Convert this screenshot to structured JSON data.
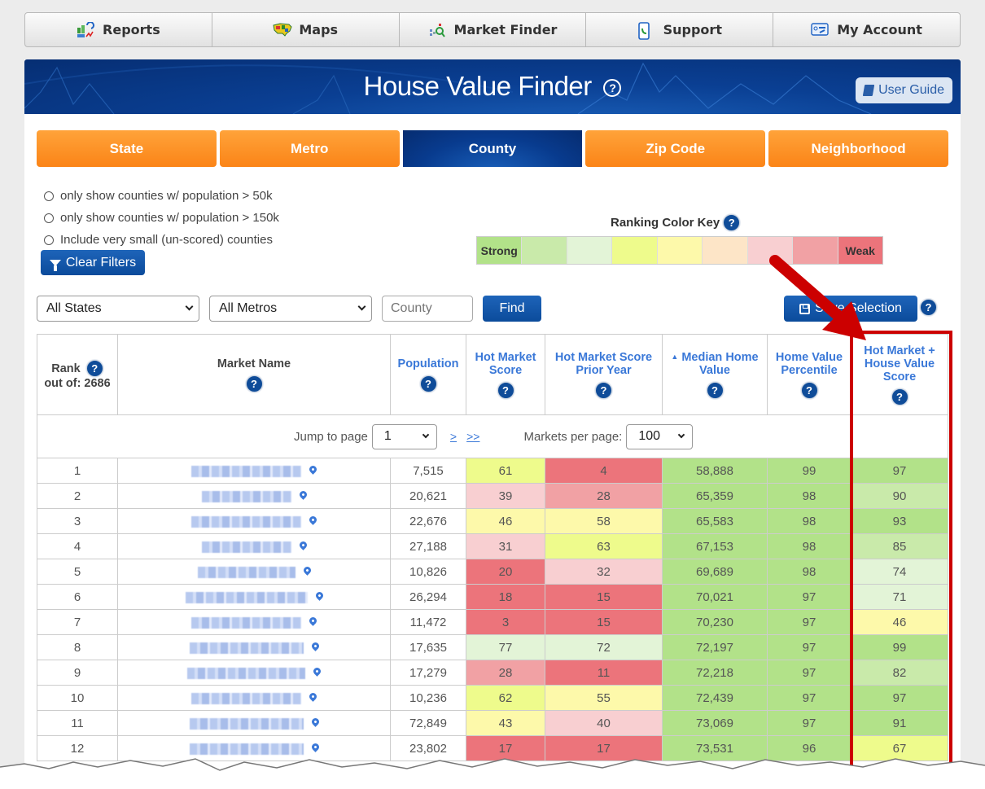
{
  "nav": {
    "items": [
      {
        "label": "Reports",
        "icon": "reports-chart-icon"
      },
      {
        "label": "Maps",
        "icon": "us-map-icon"
      },
      {
        "label": "Market Finder",
        "icon": "magnifier-icon"
      },
      {
        "label": "Support",
        "icon": "phone-icon"
      },
      {
        "label": "My Account",
        "icon": "account-card-icon"
      }
    ]
  },
  "header": {
    "title": "House Value Finder",
    "help_glyph": "?",
    "user_guide_label": "User Guide"
  },
  "tabs": [
    {
      "label": "State",
      "active": false
    },
    {
      "label": "Metro",
      "active": false
    },
    {
      "label": "County",
      "active": true
    },
    {
      "label": "Zip Code",
      "active": false
    },
    {
      "label": "Neighborhood",
      "active": false
    }
  ],
  "filters": {
    "options": [
      {
        "label": "only show counties w/ population > 50k",
        "checked": false
      },
      {
        "label": "only show counties w/ population > 150k",
        "checked": false
      },
      {
        "label": "Include very small (un-scored) counties",
        "checked": false
      }
    ],
    "clear_label": "Clear Filters"
  },
  "color_key": {
    "title": "Ranking Color Key",
    "strong_label": "Strong",
    "weak_label": "Weak",
    "colors": [
      "#b2e289",
      "#c9eaaa",
      "#e3f4d7",
      "#eefb8c",
      "#fdf9aa",
      "#fde5c7",
      "#f8cfd1",
      "#f1a1a4",
      "#ec747b"
    ]
  },
  "search": {
    "state_select": "All States",
    "metro_select": "All Metros",
    "county_placeholder": "County",
    "find_label": "Find",
    "save_label": "Save Selection",
    "help_glyph": "?"
  },
  "table": {
    "columns": [
      {
        "label": "Rank",
        "sub": "out of: 2686",
        "link": false
      },
      {
        "label": "Market Name",
        "link": false
      },
      {
        "label": "Population",
        "link": true
      },
      {
        "label": "Hot Market Score",
        "link": true
      },
      {
        "label": "Hot Market Score Prior Year",
        "link": true
      },
      {
        "label": "Median Home Value",
        "link": true,
        "sorted": "asc",
        "sort_glyph": "▲"
      },
      {
        "label": "Home Value Percentile",
        "link": true
      },
      {
        "label": "Hot Market + House Value Score",
        "link": true
      }
    ],
    "pager": {
      "jump_label": "Jump to page",
      "page": "1",
      "next": ">",
      "last": ">>",
      "per_page_label": "Markets per page:",
      "per_page": "100"
    },
    "rows": [
      {
        "rank": "1",
        "name_width": 135,
        "pop": "7,515",
        "hms": "61",
        "hms_c": 3,
        "prior": "4",
        "prior_c": 8,
        "mhv": "58,888",
        "pct": "99",
        "combo": "97",
        "combo_c": 0
      },
      {
        "rank": "2",
        "name_width": 110,
        "pop": "20,621",
        "hms": "39",
        "hms_c": 6,
        "prior": "28",
        "prior_c": 7,
        "mhv": "65,359",
        "pct": "98",
        "combo": "90",
        "combo_c": 1
      },
      {
        "rank": "3",
        "name_width": 135,
        "pop": "22,676",
        "hms": "46",
        "hms_c": 4,
        "prior": "58",
        "prior_c": 4,
        "mhv": "65,583",
        "pct": "98",
        "combo": "93",
        "combo_c": 0
      },
      {
        "rank": "4",
        "name_width": 110,
        "pop": "27,188",
        "hms": "31",
        "hms_c": 6,
        "prior": "63",
        "prior_c": 3,
        "mhv": "67,153",
        "pct": "98",
        "combo": "85",
        "combo_c": 1
      },
      {
        "rank": "5",
        "name_width": 120,
        "pop": "10,826",
        "hms": "20",
        "hms_c": 8,
        "prior": "32",
        "prior_c": 6,
        "mhv": "69,689",
        "pct": "98",
        "combo": "74",
        "combo_c": 2
      },
      {
        "rank": "6",
        "name_width": 150,
        "pop": "26,294",
        "hms": "18",
        "hms_c": 8,
        "prior": "15",
        "prior_c": 8,
        "mhv": "70,021",
        "pct": "97",
        "combo": "71",
        "combo_c": 2
      },
      {
        "rank": "7",
        "name_width": 135,
        "pop": "11,472",
        "hms": "3",
        "hms_c": 8,
        "prior": "15",
        "prior_c": 8,
        "mhv": "70,230",
        "pct": "97",
        "combo": "46",
        "combo_c": 4
      },
      {
        "rank": "8",
        "name_width": 140,
        "pop": "17,635",
        "hms": "77",
        "hms_c": 2,
        "prior": "72",
        "prior_c": 2,
        "mhv": "72,197",
        "pct": "97",
        "combo": "99",
        "combo_c": 0
      },
      {
        "rank": "9",
        "name_width": 145,
        "pop": "17,279",
        "hms": "28",
        "hms_c": 7,
        "prior": "11",
        "prior_c": 8,
        "mhv": "72,218",
        "pct": "97",
        "combo": "82",
        "combo_c": 1
      },
      {
        "rank": "10",
        "name_width": 135,
        "pop": "10,236",
        "hms": "62",
        "hms_c": 3,
        "prior": "55",
        "prior_c": 4,
        "mhv": "72,439",
        "pct": "97",
        "combo": "97",
        "combo_c": 0
      },
      {
        "rank": "11",
        "name_width": 140,
        "pop": "72,849",
        "hms": "43",
        "hms_c": 4,
        "prior": "40",
        "prior_c": 6,
        "mhv": "73,069",
        "pct": "97",
        "combo": "91",
        "combo_c": 0
      },
      {
        "rank": "12",
        "name_width": 140,
        "pop": "23,802",
        "hms": "17",
        "hms_c": 8,
        "prior": "17",
        "prior_c": 8,
        "mhv": "73,531",
        "pct": "96",
        "combo": "67",
        "combo_c": 3
      }
    ]
  },
  "annotation": {
    "color": "#cc0000"
  }
}
